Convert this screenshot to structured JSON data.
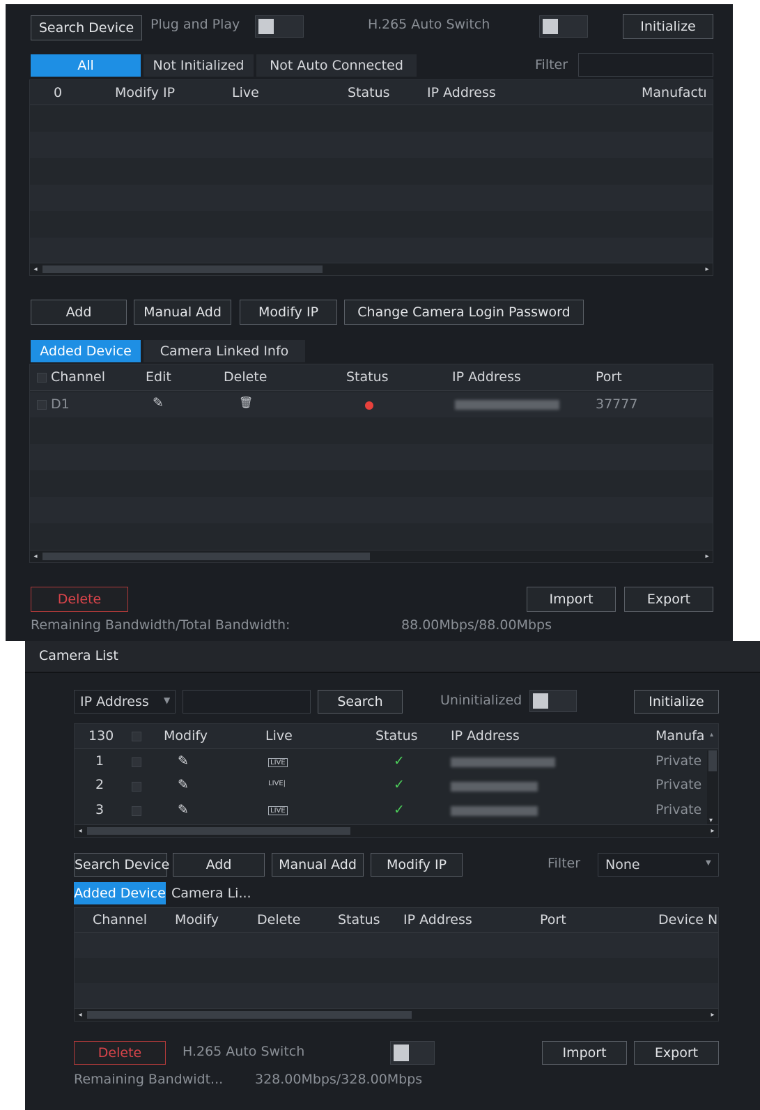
{
  "top": {
    "search_device": "Search Device",
    "plug_and_play": "Plug and Play",
    "h265_auto_switch": "H.265 Auto Switch",
    "initialize": "Initialize",
    "tabs": [
      "All",
      "Not Initialized",
      "Not Auto Connected"
    ],
    "filter_label": "Filter",
    "search_columns": [
      "0",
      "Modify IP",
      "Live",
      "Status",
      "IP Address",
      "Manufactı"
    ],
    "actions": [
      "Add",
      "Manual Add",
      "Modify IP",
      "Change Camera Login Password"
    ],
    "device_tabs": [
      "Added Device",
      "Camera Linked Info"
    ],
    "added_columns": [
      "Channel",
      "Edit",
      "Delete",
      "Status",
      "IP Address",
      "Port"
    ],
    "added_rows": [
      {
        "channel": "D1",
        "port": "37777",
        "status_color": "#e8413c"
      }
    ],
    "delete": "Delete",
    "import": "Import",
    "export": "Export",
    "bandwidth_label": "Remaining Bandwidth/Total Bandwidth:",
    "bandwidth_value": "88.00Mbps/88.00Mbps"
  },
  "bottom": {
    "title": "Camera List",
    "search_by": "IP Address",
    "search": "Search",
    "uninitialized": "Uninitialized",
    "initialize": "Initialize",
    "columns": [
      "130",
      "Modify",
      "Live",
      "Status",
      "IP Address",
      "Manufa"
    ],
    "rows": [
      {
        "num": "1",
        "live": "LIVE",
        "manufacturer": "Private"
      },
      {
        "num": "2",
        "live": "LIVE|",
        "manufacturer": "Private"
      },
      {
        "num": "3",
        "live": "LIVE",
        "manufacturer": "Private"
      }
    ],
    "actions": [
      "Search Device",
      "Add",
      "Manual Add",
      "Modify IP"
    ],
    "filter_label": "Filter",
    "filter_value": "None",
    "device_tabs": [
      "Added Device",
      "Camera Li..."
    ],
    "added_columns": [
      "Channel",
      "Modify",
      "Delete",
      "Status",
      "IP Address",
      "Port",
      "Device Na"
    ],
    "delete": "Delete",
    "h265_auto_switch": "H.265 Auto Switch",
    "import": "Import",
    "export": "Export",
    "bandwidth_label": "Remaining Bandwidt...",
    "bandwidth_value": "328.00Mbps/328.00Mbps"
  },
  "colors": {
    "accent": "#1e8fe4",
    "ok": "#4ccf5a",
    "danger": "#d9444a"
  }
}
